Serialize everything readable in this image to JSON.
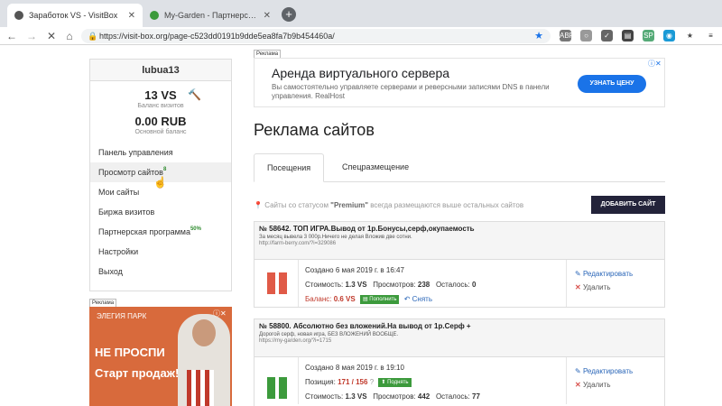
{
  "browser": {
    "tabs": [
      {
        "title": "Заработок VS - VisitBox",
        "active": true
      },
      {
        "title": "My-Garden - Партнерская прог...",
        "active": false
      }
    ],
    "url": "https://visit-box.org/page-c523dd0191b9dde5ea8fa7b9b454460a/",
    "extensions": [
      "ABP",
      "○",
      "✓",
      "▤",
      "SP",
      "◉",
      "★",
      "≡",
      "⋮"
    ]
  },
  "sidebar": {
    "username": "lubua13",
    "vs_balance": "13 VS",
    "vs_label": "Баланс визитов",
    "rub_balance": "0.00 RUB",
    "rub_label": "Основной баланс",
    "menu": [
      {
        "label": "Панель управления",
        "badge": ""
      },
      {
        "label": "Просмотр сайтов",
        "badge": "8"
      },
      {
        "label": "Мои сайты",
        "badge": ""
      },
      {
        "label": "Биржа визитов",
        "badge": ""
      },
      {
        "label": "Партнерская программа",
        "badge": "50%"
      },
      {
        "label": "Настройки",
        "badge": ""
      },
      {
        "label": "Выход",
        "badge": ""
      }
    ]
  },
  "ads": {
    "label": "Реклама",
    "top": {
      "headline": "Аренда виртуального сервера",
      "description": "Вы самостоятельно управляете серверами и реверсными записями DNS в панели управления. RealHost",
      "cta": "УЗНАТЬ ЦЕНУ"
    },
    "side": {
      "logo": "ЭЛЕГИЯ ПАРК",
      "headline": "НЕ ПРОСПИ",
      "subheadline": "Старт продаж!"
    }
  },
  "main": {
    "title": "Реклама сайтов",
    "tabs": [
      "Посещения",
      "Спецразмещение"
    ],
    "premium_note_prefix": "Сайты со статусом",
    "premium_word": "\"Premium\"",
    "premium_note_suffix": "всегда размещаются выше остальных сайтов",
    "add_button": "ДОБАВИТЬ САЙТ"
  },
  "sites": [
    {
      "title": "№ 58642. ТОП ИГРА.Вывод от 1р.Бонусы,серф,окупаемость",
      "description": "За месяц вывела 3 000р.Ничего не делая Вложив две сотни.",
      "url": "http://farm-berry.com/?i=329086",
      "created": "Создано 6 мая 2019 г. в 16:47",
      "cost_label": "Стоимость:",
      "cost": "1.3 VS",
      "views_label": "Просмотров:",
      "views": "238",
      "left_label": "Осталось:",
      "left": "0",
      "balance_label": "Баланс:",
      "balance": "0.6 VS",
      "topup": "Пополнить",
      "withdraw": "Снять",
      "edit": "Редактировать",
      "delete": "Удалить",
      "state": "paused",
      "state_color": "#e05a47"
    },
    {
      "title": "№ 58800. Абсолютно без вложений.На вывод от 1р.Серф +",
      "description": "Дорогой серф, новая игра, БЕЗ ВЛОЖЕНИЙ ВООБЩЕ.",
      "url": "https://my-garden.org/?i=1715",
      "created": "Создано 8 мая 2019 г. в 19:10",
      "position_label": "Позиция:",
      "position": "171 / 156",
      "raise": "Поднять",
      "cost_label": "Стоимость:",
      "cost": "1.3 VS",
      "views_label": "Просмотров:",
      "views": "442",
      "left_label": "Осталось:",
      "left": "77",
      "edit": "Редактировать",
      "delete": "Удалить",
      "state": "paused",
      "state_color": "#3c9a3c"
    }
  ]
}
